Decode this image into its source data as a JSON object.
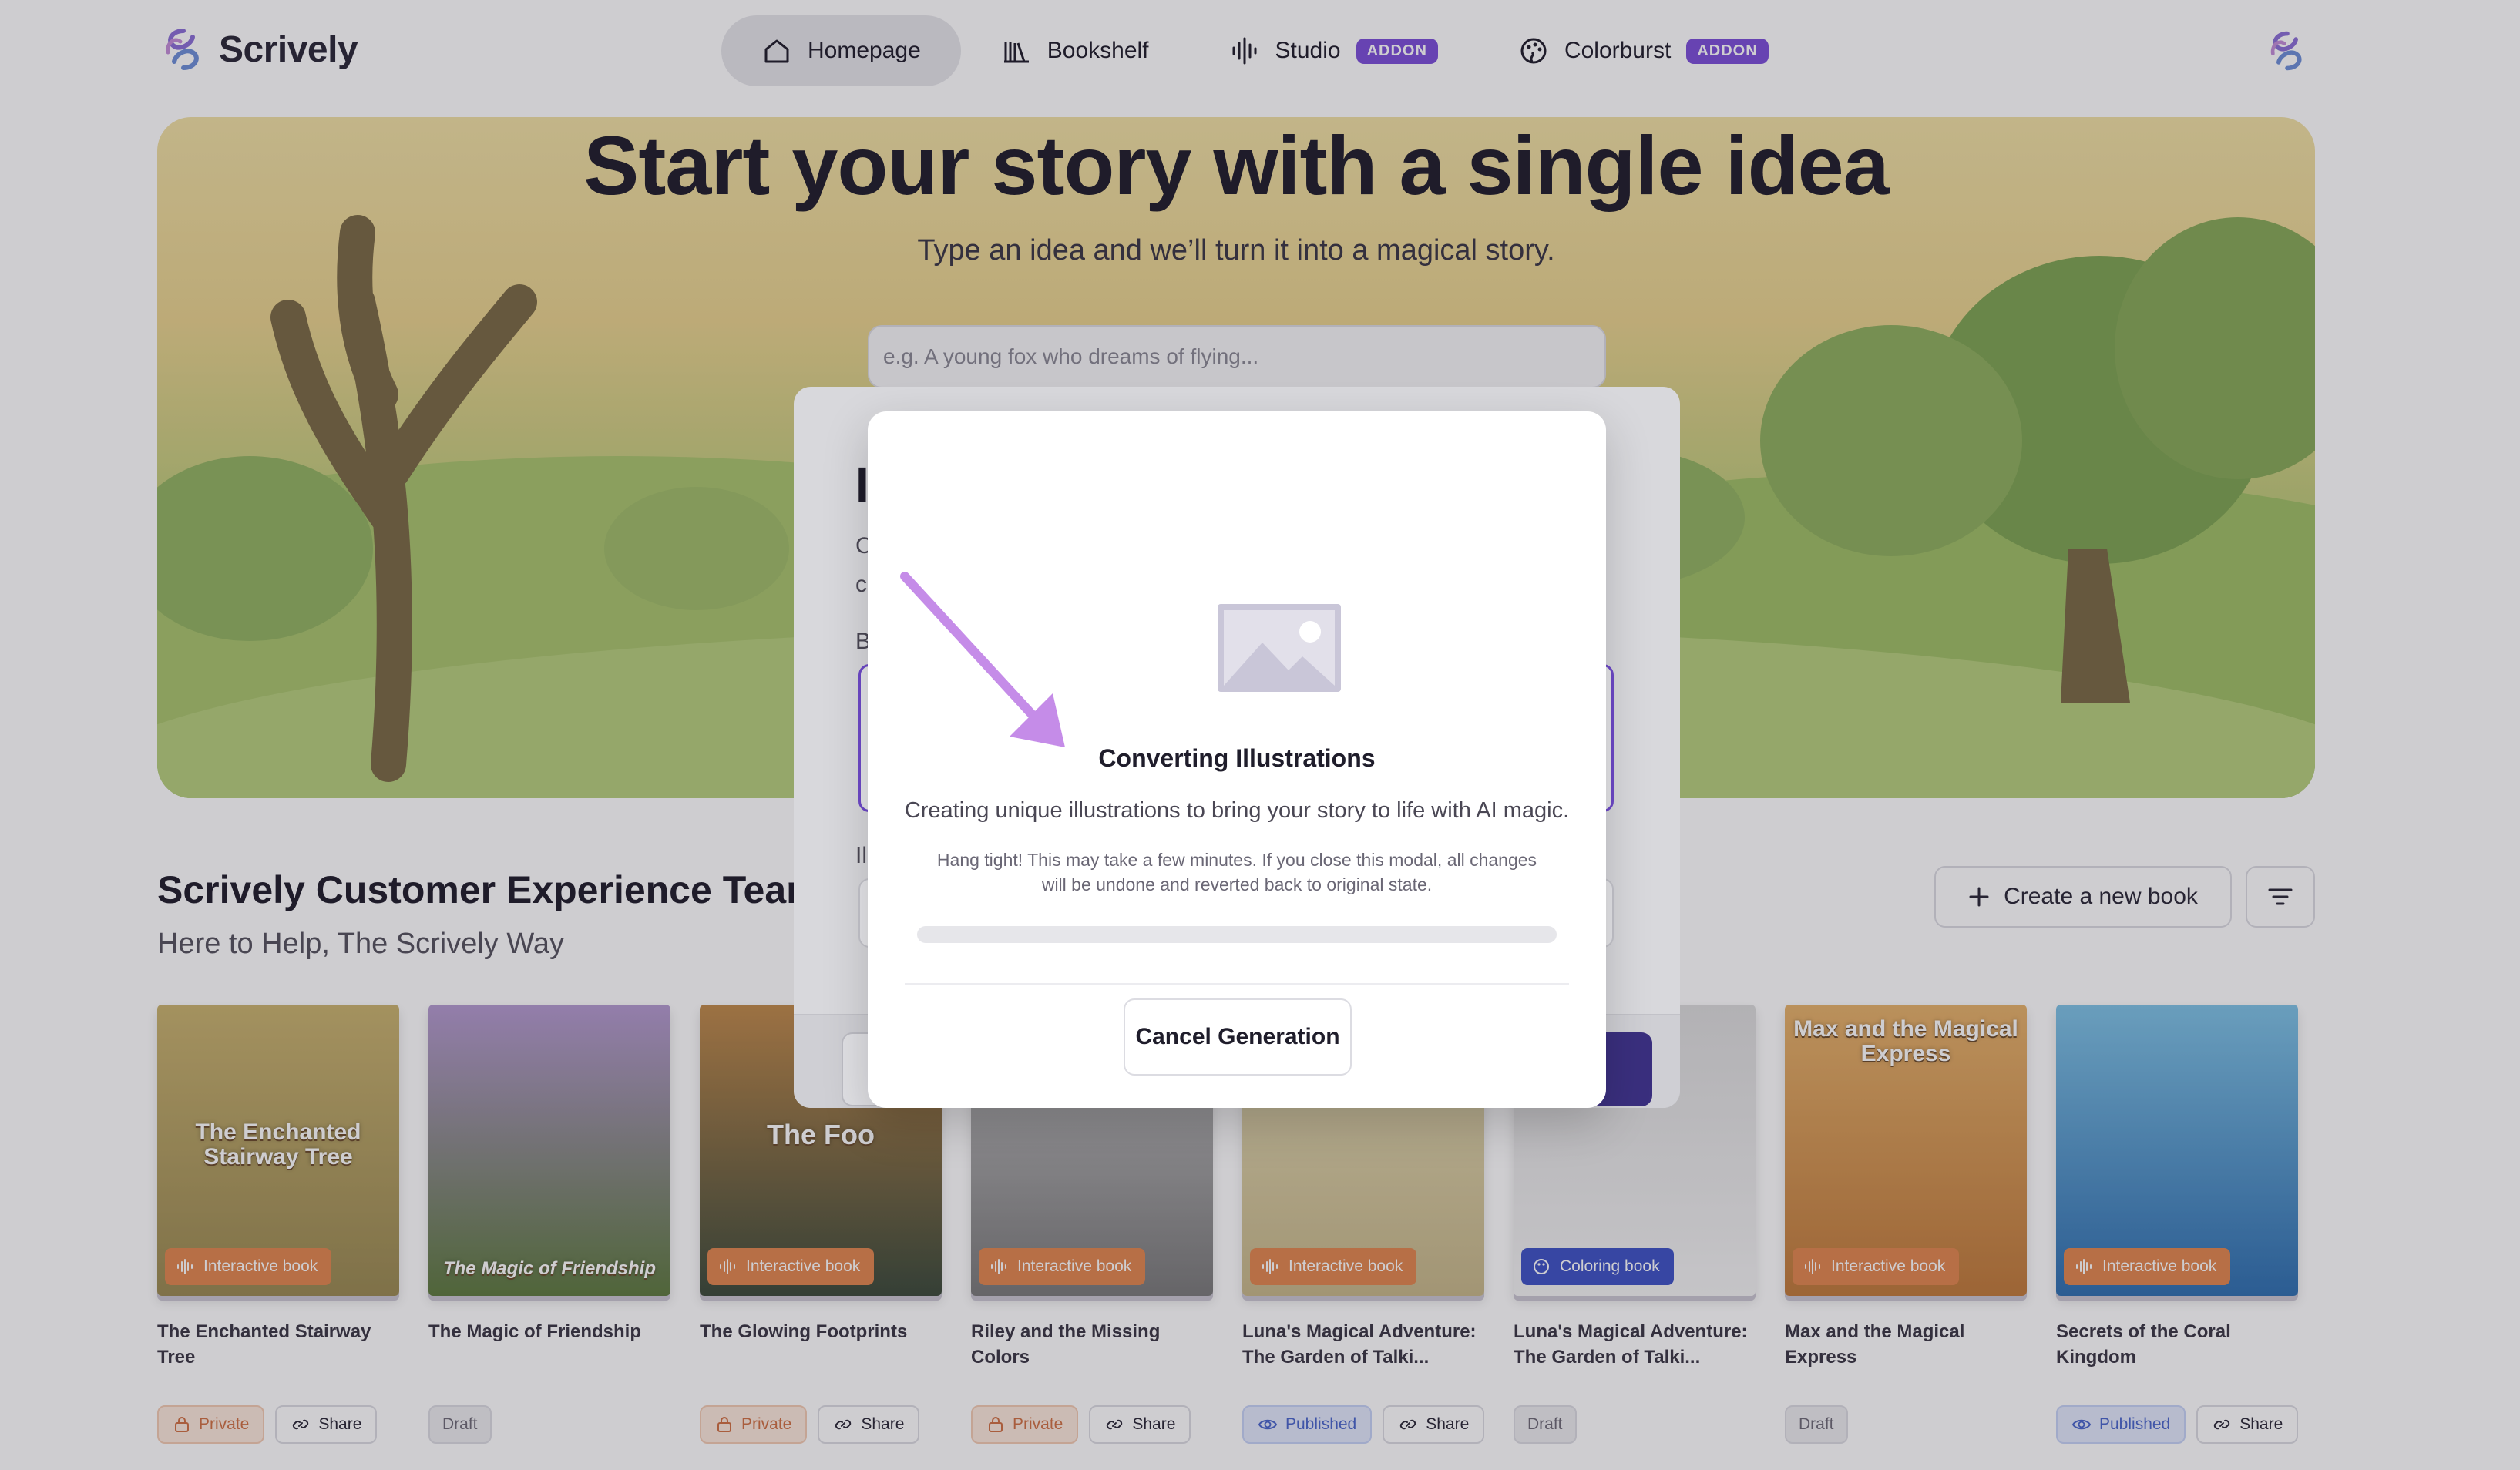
{
  "app": {
    "name": "Scrively"
  },
  "nav": {
    "items": [
      {
        "label": "Homepage",
        "icon": "home-icon",
        "active": true,
        "addon": ""
      },
      {
        "label": "Bookshelf",
        "icon": "bookshelf-icon",
        "active": false,
        "addon": ""
      },
      {
        "label": "Studio",
        "icon": "audio-wave-icon",
        "active": false,
        "addon": "ADDON"
      },
      {
        "label": "Colorburst",
        "icon": "palette-icon",
        "active": false,
        "addon": "ADDON"
      }
    ]
  },
  "hero": {
    "title": "Start your story with a single idea",
    "subtitle": "Type an idea and we’ll turn it into a magical story.",
    "input_placeholder": "e.g. A young fox who dreams of flying..."
  },
  "team": {
    "title": "Scrively Customer Experience Team",
    "subtitle": "Here to Help, The Scrively Way",
    "create_label": "Create a new book"
  },
  "books": [
    {
      "title": "The Enchanted Stairway Tree",
      "cover_text": "The Enchanted Stairway Tree",
      "type": "Interactive book",
      "kind": "interactive",
      "status": "Private",
      "share": "Share",
      "bg": [
        "#9a8a52",
        "#c9b36f"
      ]
    },
    {
      "title": "The Magic of Friendship",
      "cover_text": "The Magic of Friendship",
      "type": "",
      "kind": "",
      "status": "Draft",
      "share": "",
      "bg": [
        "#5e7a3f",
        "#b49ad0"
      ]
    },
    {
      "title": "The Glowing Footprints",
      "cover_text": "The Foo",
      "type": "Interactive book",
      "kind": "interactive",
      "status": "Private",
      "share": "Share",
      "bg": [
        "#3b4a3a",
        "#c08a4a"
      ]
    },
    {
      "title": "Riley and the Missing Colors",
      "cover_text": "",
      "type": "Interactive book",
      "kind": "interactive",
      "status": "Private",
      "share": "Share",
      "bg": [
        "#7a7a7a",
        "#c9c9c9"
      ]
    },
    {
      "title": "Luna's Magical Adventure: The Garden of Talki...",
      "cover_text": "",
      "type": "Interactive book",
      "kind": "interactive",
      "status": "Published",
      "share": "Share",
      "bg": [
        "#c7b88a",
        "#e8dfb8"
      ]
    },
    {
      "title": "Luna's Magical Adventure: The Garden of Talki...",
      "cover_text": "",
      "type": "Coloring book",
      "kind": "coloring",
      "status": "Draft",
      "share": "",
      "bg": [
        "#f4f4f4",
        "#dcdcdc"
      ]
    },
    {
      "title": "Max and the Magical Express",
      "cover_text": "Max and the Magical Express",
      "type": "Interactive book",
      "kind": "interactive",
      "status": "Draft",
      "share": "",
      "bg": [
        "#c07a3a",
        "#e6b26a"
      ]
    },
    {
      "title": "Secrets of the Coral Kingdom",
      "cover_text": "",
      "type": "Interactive book",
      "kind": "interactive",
      "status": "Published",
      "share": "Share",
      "bg": [
        "#2f6fb0",
        "#7fc3e6"
      ]
    }
  ],
  "back_modal": {
    "title_fragment": "I",
    "line1": "C",
    "line2": "c",
    "label1": "B",
    "label2": "Il"
  },
  "modal": {
    "title": "Converting Illustrations",
    "description": "Creating unique illustrations to bring your story to life with AI magic.",
    "note": "Hang tight! This may take a few minutes. If you close this modal, all changes will be undone and reverted back to original state.",
    "progress": 0,
    "cancel_label": "Cancel Generation"
  },
  "colors": {
    "accent": "#7b4fd9",
    "private": "#d07043",
    "published": "#4a66cc",
    "interactive_badge": "#e2874f",
    "coloring_badge": "#3e53c6"
  }
}
